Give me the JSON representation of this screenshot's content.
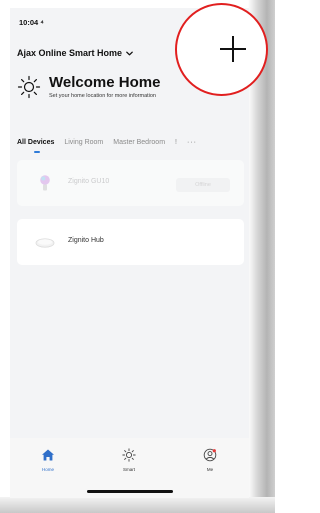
{
  "status_bar": {
    "time": "10:04 ⁴"
  },
  "header": {
    "home_name": "Ajax Online Smart Home",
    "welcome_title": "Welcome Home",
    "welcome_subtitle": "Set your home location for more information",
    "sun_icon": "sun-icon",
    "chevron_icon": "chevron-down-icon",
    "add_icon": "plus-icon"
  },
  "tabs": {
    "items": [
      {
        "label": "All Devices",
        "active": true
      },
      {
        "label": "Living Room",
        "active": false
      },
      {
        "label": "Master Bedroom",
        "active": false
      },
      {
        "label": "!",
        "active": false
      }
    ],
    "more": "···"
  },
  "devices": [
    {
      "name": "Zignito GU10",
      "status": "Offline",
      "icon": "bulb-icon"
    },
    {
      "name": "Zignito Hub",
      "status": "",
      "icon": "hub-icon"
    }
  ],
  "bottom_nav": {
    "items": [
      {
        "label": "Home",
        "icon": "home-icon",
        "active": true
      },
      {
        "label": "Smart",
        "icon": "smart-sun-icon",
        "active": false
      },
      {
        "label": "Me",
        "icon": "profile-icon",
        "active": false
      }
    ]
  },
  "colors": {
    "accent": "#2f7bd8",
    "annotation_circle": "#e11f1f"
  }
}
